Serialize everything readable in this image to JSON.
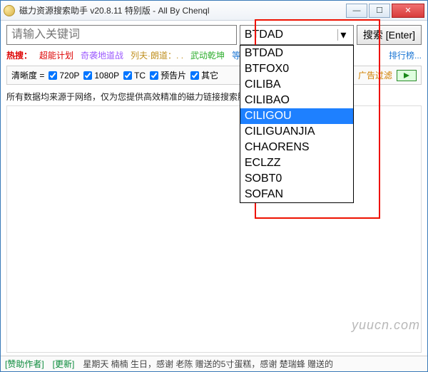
{
  "title": "磁力资源搜索助手 v20.8.11 特别版 - All By Chenql",
  "search": {
    "placeholder": "请输入关键词",
    "button": "搜索 [Enter]"
  },
  "dropdown": {
    "selected": "BTDAD",
    "options": [
      "BTDAD",
      "BTFOX0",
      "CILIBA",
      "CILIBAO",
      "CILIGOU",
      "CILIGUANJIA",
      "CHAORENS",
      "ECLZZ",
      "SOBT0",
      "SOFAN"
    ],
    "highlight_index": 4
  },
  "hot": {
    "label": "热搜：",
    "items": [
      "超能计划",
      "奇袭地道战",
      "列夫·朗道：. .",
      "武动乾坤",
      "等待野蛮人"
    ],
    "rank": "排行榜..."
  },
  "filters": {
    "label": "清晰度 =",
    "opts": [
      "720P",
      "1080P",
      "TC",
      "预告片",
      "其它"
    ],
    "ad": "广告过滤"
  },
  "info": "所有数据均来源于网络，仅为您提供高效精准的磁力链接搜索服务！",
  "status": {
    "sponsor": "[赞助作者]",
    "update": "[更新]",
    "msg": "星期天 楠楠 生日，感谢 老陈 赠送的5寸蛋糕，感谢 楚瑞蜂 赠送的"
  },
  "watermark": "yuucn.com"
}
